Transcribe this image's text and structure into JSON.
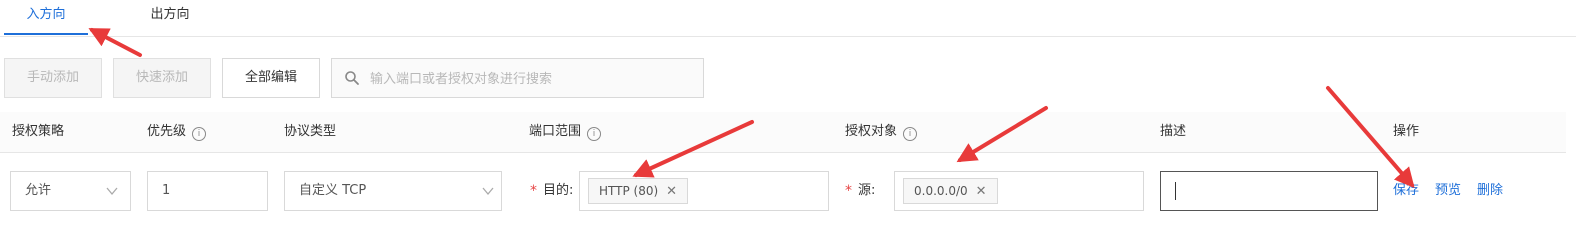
{
  "tabs": {
    "inbound": "入方向",
    "outbound": "出方向"
  },
  "toolbar": {
    "manual_add": "手动添加",
    "quick_add": "快速添加",
    "edit_all": "全部编辑",
    "search_placeholder": "输入端口或者授权对象进行搜索"
  },
  "table": {
    "headers": {
      "policy": "授权策略",
      "priority": "优先级",
      "protocol": "协议类型",
      "port_range": "端口范围",
      "auth_object": "授权对象",
      "description": "描述",
      "actions": "操作"
    },
    "row": {
      "policy": "允许",
      "priority": "1",
      "protocol": "自定义 TCP",
      "required_mark": "*",
      "dest_label": "目的:",
      "dest_tag": "HTTP (80)",
      "source_label": "源:",
      "source_tag": "0.0.0.0/0",
      "description": "",
      "actions": {
        "save": "保存",
        "preview": "预览",
        "delete": "删除"
      }
    }
  },
  "colors": {
    "accent": "#1e6fd9",
    "required": "#e64545",
    "annotation_arrow": "#e83a3a"
  },
  "icons": [
    "search-icon",
    "chevron-down-icon",
    "info-icon",
    "close-icon",
    "annotation-arrow"
  ]
}
